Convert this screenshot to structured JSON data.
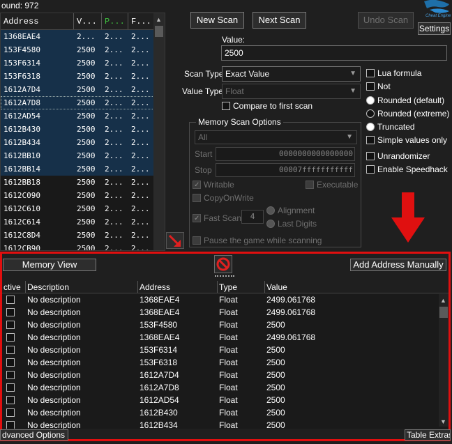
{
  "found_label": "ound: 972",
  "results": {
    "headers": [
      "Address",
      "V...",
      "P...",
      "F..."
    ],
    "rows": [
      {
        "address": "1368EAE4",
        "v": "2...",
        "p": "2...",
        "f": "2..."
      },
      {
        "address": "153F4580",
        "v": "2500",
        "p": "2...",
        "f": "2..."
      },
      {
        "address": "153F6314",
        "v": "2500",
        "p": "2...",
        "f": "2..."
      },
      {
        "address": "153F6318",
        "v": "2500",
        "p": "2...",
        "f": "2..."
      },
      {
        "address": "1612A7D4",
        "v": "2500",
        "p": "2...",
        "f": "2..."
      },
      {
        "address": "1612A7D8",
        "v": "2500",
        "p": "2...",
        "f": "2..."
      },
      {
        "address": "1612AD54",
        "v": "2500",
        "p": "2...",
        "f": "2..."
      },
      {
        "address": "1612B430",
        "v": "2500",
        "p": "2...",
        "f": "2..."
      },
      {
        "address": "1612B434",
        "v": "2500",
        "p": "2...",
        "f": "2..."
      },
      {
        "address": "1612BB10",
        "v": "2500",
        "p": "2...",
        "f": "2..."
      },
      {
        "address": "1612BB14",
        "v": "2500",
        "p": "2...",
        "f": "2..."
      },
      {
        "address": "1612BB18",
        "v": "2500",
        "p": "2...",
        "f": "2..."
      },
      {
        "address": "1612C090",
        "v": "2500",
        "p": "2...",
        "f": "2..."
      },
      {
        "address": "1612C610",
        "v": "2500",
        "p": "2...",
        "f": "2..."
      },
      {
        "address": "1612C614",
        "v": "2500",
        "p": "2...",
        "f": "2..."
      },
      {
        "address": "1612C8D4",
        "v": "2500",
        "p": "2...",
        "f": "2..."
      },
      {
        "address": "1612CB90",
        "v": "2500",
        "p": "2...",
        "f": "2..."
      }
    ]
  },
  "buttons": {
    "new_scan": "New Scan",
    "next_scan": "Next Scan",
    "undo_scan": "Undo Scan",
    "settings": "Settings",
    "memory_view": "Memory View",
    "add_address": "Add Address Manually",
    "advanced_options": "dvanced Options",
    "table_extras": "Table Extras"
  },
  "logo_text": "Cheat Engine",
  "value": {
    "label": "Value:",
    "input": "2500"
  },
  "scan_type": {
    "label": "Scan Type",
    "selected": "Exact Value"
  },
  "value_type": {
    "label": "Value Type",
    "selected": "Float"
  },
  "compare_first": "Compare to first scan",
  "right_options": {
    "lua_formula": "Lua formula",
    "not": "Not",
    "rounded_default": "Rounded (default)",
    "rounded_extreme": "Rounded (extreme)",
    "truncated": "Truncated",
    "simple_values": "Simple values only",
    "unrandomizer": "Unrandomizer",
    "speedhack": "Enable Speedhack"
  },
  "memory_scan": {
    "title": "Memory Scan Options",
    "region": "All",
    "start_label": "Start",
    "start_value": "0000000000000000",
    "stop_label": "Stop",
    "stop_value": "00007fffffffffff",
    "writable": "Writable",
    "executable": "Executable",
    "copy_on_write": "CopyOnWrite",
    "fast_scan": "Fast Scan",
    "fast_scan_value": "4",
    "alignment": "Alignment",
    "last_digits": "Last Digits",
    "pause_game": "Pause the game while scanning"
  },
  "address_table": {
    "headers": [
      "ctive",
      "Description",
      "Address",
      "Type",
      "Value"
    ],
    "rows": [
      {
        "description": "No description",
        "address": "1368EAE4",
        "type": "Float",
        "value": "2499.061768"
      },
      {
        "description": "No description",
        "address": "1368EAE4",
        "type": "Float",
        "value": "2499.061768"
      },
      {
        "description": "No description",
        "address": "153F4580",
        "type": "Float",
        "value": "2500"
      },
      {
        "description": "No description",
        "address": "1368EAE4",
        "type": "Float",
        "value": "2499.061768"
      },
      {
        "description": "No description",
        "address": "153F6314",
        "type": "Float",
        "value": "2500"
      },
      {
        "description": "No description",
        "address": "153F6318",
        "type": "Float",
        "value": "2500"
      },
      {
        "description": "No description",
        "address": "1612A7D4",
        "type": "Float",
        "value": "2500"
      },
      {
        "description": "No description",
        "address": "1612A7D8",
        "type": "Float",
        "value": "2500"
      },
      {
        "description": "No description",
        "address": "1612AD54",
        "type": "Float",
        "value": "2500"
      },
      {
        "description": "No description",
        "address": "1612B430",
        "type": "Float",
        "value": "2500"
      },
      {
        "description": "No description",
        "address": "1612B434",
        "type": "Float",
        "value": "2500"
      }
    ]
  },
  "colors": {
    "highlight": "#e10f0f",
    "selection": "#163049"
  }
}
